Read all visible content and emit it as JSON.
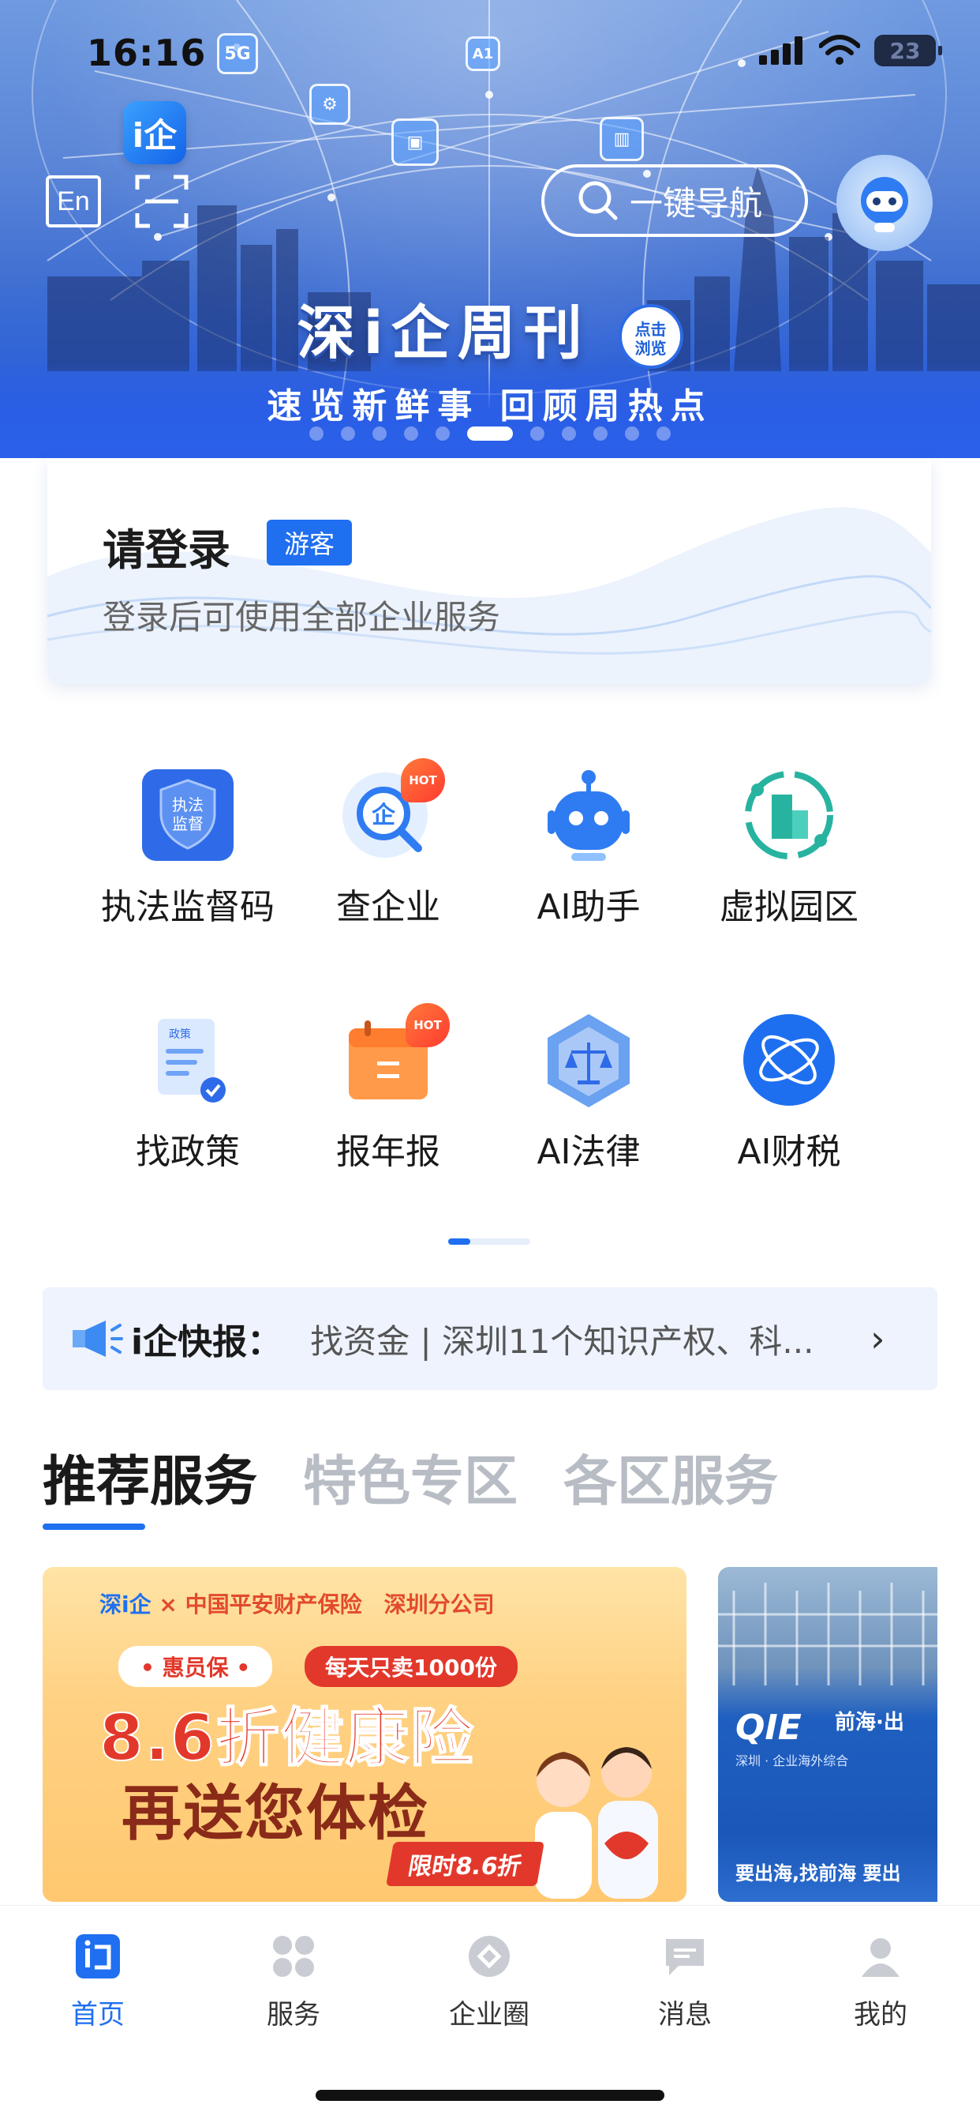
{
  "status_bar": {
    "time": "16:16",
    "battery": "23"
  },
  "header": {
    "app_logo": "i企",
    "lang_button": "En",
    "search_label": "一键导航",
    "floating_badges": [
      "5G",
      "A1"
    ]
  },
  "banner": {
    "title": "深i企周刊",
    "bubble_line1": "点击",
    "bubble_line2": "浏览",
    "subtitle": "速览新鲜事 回顾周热点",
    "slide_count": 11,
    "active_slide": 5
  },
  "login": {
    "title": "请登录",
    "badge": "游客",
    "subtitle": "登录后可使用全部企业服务"
  },
  "services": [
    {
      "label": "执法监督码",
      "icon": "law-supervision-code-icon",
      "hot": false
    },
    {
      "label": "查企业",
      "icon": "enterprise-search-icon",
      "hot": true
    },
    {
      "label": "AI助手",
      "icon": "ai-robot-icon",
      "hot": false
    },
    {
      "label": "虚拟园区",
      "icon": "virtual-park-icon",
      "hot": false
    },
    {
      "label": "找政策",
      "icon": "policy-document-icon",
      "hot": false
    },
    {
      "label": "报年报",
      "icon": "annual-report-calendar-icon",
      "hot": true
    },
    {
      "label": "AI法律",
      "icon": "ai-law-scale-icon",
      "hot": false
    },
    {
      "label": "AI财税",
      "icon": "ai-tax-orbit-icon",
      "hot": false
    }
  ],
  "hot_label": "HOT",
  "service_icon_text": {
    "law_line1": "执法",
    "law_line2": "监督",
    "enterprise": "企",
    "policy": "政策"
  },
  "news": {
    "tag": "i企快报：",
    "text": "找资金 | 深圳11个知识产权、科...",
    "chevron": "›"
  },
  "section_tabs": [
    {
      "label": "推荐服务",
      "active": true
    },
    {
      "label": "特色专区",
      "active": false
    },
    {
      "label": "各区服务",
      "active": false
    }
  ],
  "promo_cards": {
    "card1": {
      "brand_left": "深i企",
      "brand_x": "×",
      "brand_right": "中国平安财产保险　深圳分公司",
      "pill1": "• 惠员保 •",
      "pill2": "每天只卖1000份",
      "headline1": "8.6折健康险",
      "headline2": "再送您体检",
      "limit": "限时8.6折"
    },
    "card2": {
      "logo": "QIE",
      "name": "前海·出",
      "sub": "深圳 · 企业海外综合",
      "bottom": "要出海,找前海 要出"
    }
  },
  "tabbar": [
    {
      "label": "首页",
      "icon": "home-i-icon",
      "active": true
    },
    {
      "label": "服务",
      "icon": "services-grid-icon",
      "active": false
    },
    {
      "label": "企业圈",
      "icon": "enterprise-circle-icon",
      "active": false
    },
    {
      "label": "消息",
      "icon": "message-bubble-icon",
      "active": false
    },
    {
      "label": "我的",
      "icon": "profile-person-icon",
      "active": false
    }
  ],
  "colors": {
    "accent": "#1f6ff0",
    "hero_blue": "#2c5fe0",
    "hot_red": "#ff3b30",
    "news_bg": "#eef3fd"
  }
}
